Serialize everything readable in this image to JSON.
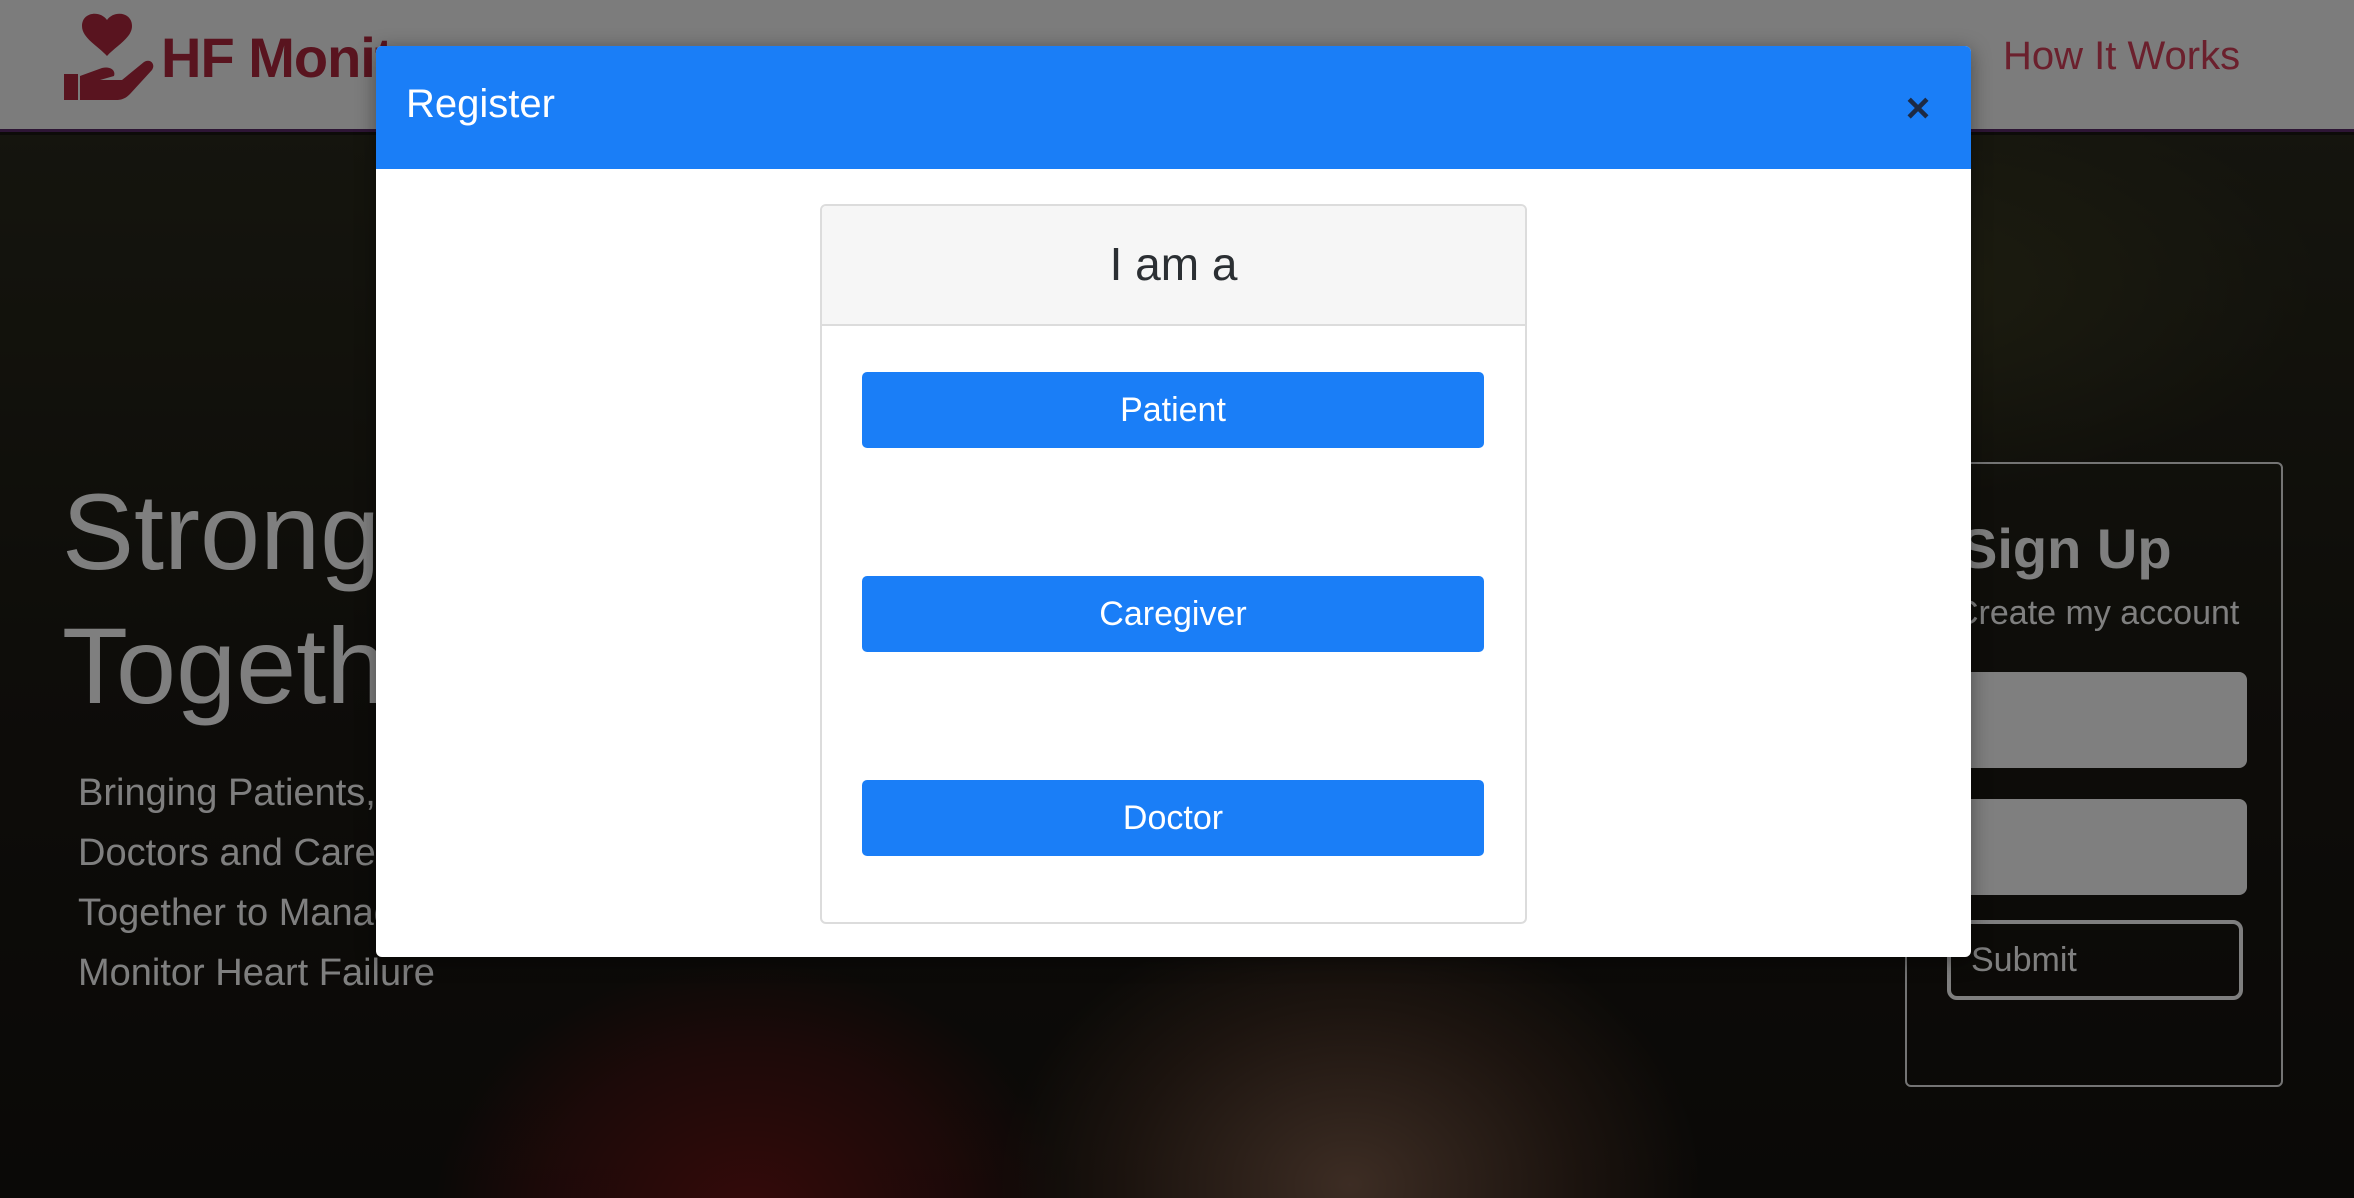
{
  "navbar": {
    "brand_text": "HF Monitor",
    "nav_link": "How It Works"
  },
  "hero": {
    "title": "Stronger Together",
    "subtitle": "Bringing Patients, Doctors and Caregivers Together to Manage and Monitor Heart Failure"
  },
  "signup": {
    "title": "Sign Up",
    "subtitle": "Create my account",
    "submit_label": "Submit"
  },
  "modal": {
    "title": "Register",
    "close_icon": "×",
    "prompt": "I am a",
    "options": [
      "Patient",
      "Caregiver",
      "Doctor"
    ]
  },
  "colors": {
    "brand": "#b2283e",
    "modal_header": "#1a7ef7",
    "button": "#1a7ef7"
  }
}
